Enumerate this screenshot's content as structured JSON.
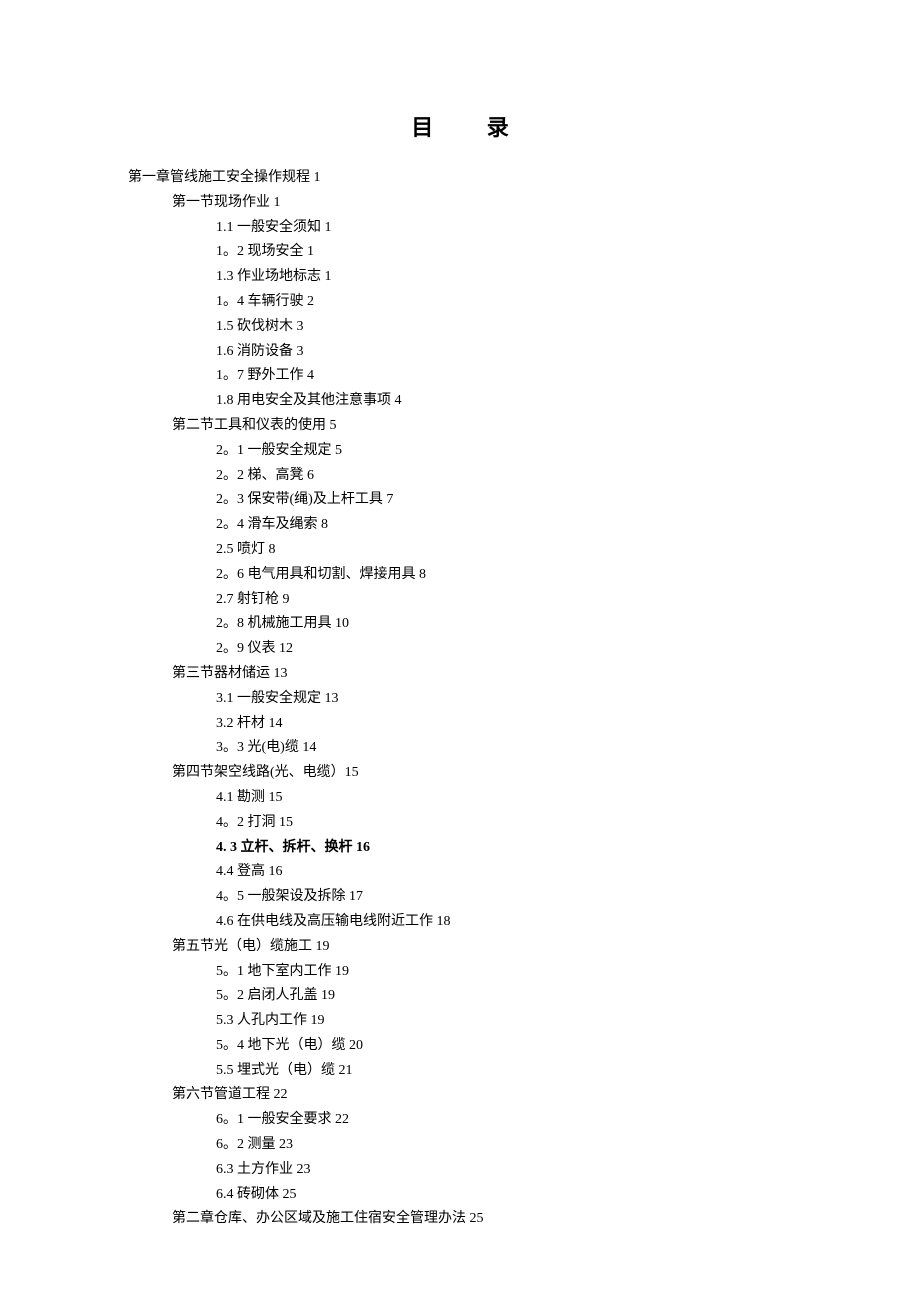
{
  "title": "目 录",
  "entries": [
    {
      "indent": 0,
      "text": "第一章管线施工安全操作规程 1",
      "bold": false
    },
    {
      "indent": 1,
      "text": "第一节现场作业 1",
      "bold": false
    },
    {
      "indent": 2,
      "text": "1.1 一般安全须知 1",
      "bold": false
    },
    {
      "indent": 2,
      "text": "1。2 现场安全 1",
      "bold": false
    },
    {
      "indent": 2,
      "text": "1.3 作业场地标志 1",
      "bold": false
    },
    {
      "indent": 2,
      "text": "1。4 车辆行驶 2",
      "bold": false
    },
    {
      "indent": 2,
      "text": "1.5 砍伐树木 3",
      "bold": false
    },
    {
      "indent": 2,
      "text": "1.6 消防设备 3",
      "bold": false
    },
    {
      "indent": 2,
      "text": "1。7 野外工作 4",
      "bold": false
    },
    {
      "indent": 2,
      "text": "1.8 用电安全及其他注意事项 4",
      "bold": false
    },
    {
      "indent": 1,
      "text": "第二节工具和仪表的使用 5",
      "bold": false
    },
    {
      "indent": 2,
      "text": "2。1 一般安全规定 5",
      "bold": false
    },
    {
      "indent": 2,
      "text": "2。2 梯、高凳 6",
      "bold": false
    },
    {
      "indent": 2,
      "text": "2。3 保安带(绳)及上杆工具 7",
      "bold": false
    },
    {
      "indent": 2,
      "text": "2。4 滑车及绳索 8",
      "bold": false
    },
    {
      "indent": 2,
      "text": "2.5 喷灯 8",
      "bold": false
    },
    {
      "indent": 2,
      "text": "2。6 电气用具和切割、焊接用具 8",
      "bold": false
    },
    {
      "indent": 2,
      "text": "2.7 射钉枪 9",
      "bold": false
    },
    {
      "indent": 2,
      "text": "2。8 机械施工用具 10",
      "bold": false
    },
    {
      "indent": 2,
      "text": "2。9 仪表 12",
      "bold": false
    },
    {
      "indent": 1,
      "text": "第三节器材储运 13",
      "bold": false
    },
    {
      "indent": 2,
      "text": "3.1 一般安全规定 13",
      "bold": false
    },
    {
      "indent": 2,
      "text": "3.2 杆材 14",
      "bold": false
    },
    {
      "indent": 2,
      "text": "3。3 光(电)缆 14",
      "bold": false
    },
    {
      "indent": 1,
      "text": "第四节架空线路(光、电缆）15",
      "bold": false
    },
    {
      "indent": 2,
      "text": "4.1 勘测 15",
      "bold": false
    },
    {
      "indent": 2,
      "text": "4。2 打洞 15",
      "bold": false
    },
    {
      "indent": 2,
      "text": "4. 3 立杆、拆杆、换杆 16",
      "bold": true
    },
    {
      "indent": 2,
      "text": "4.4 登高 16",
      "bold": false
    },
    {
      "indent": 2,
      "text": "4。5 一般架设及拆除 17",
      "bold": false
    },
    {
      "indent": 2,
      "text": "4.6 在供电线及高压输电线附近工作 18",
      "bold": false
    },
    {
      "indent": 1,
      "text": "第五节光（电）缆施工 19",
      "bold": false
    },
    {
      "indent": 2,
      "text": "5。1 地下室内工作 19",
      "bold": false
    },
    {
      "indent": 2,
      "text": "5。2 启闭人孔盖 19",
      "bold": false
    },
    {
      "indent": 2,
      "text": "5.3 人孔内工作 19",
      "bold": false
    },
    {
      "indent": 2,
      "text": "5。4 地下光（电）缆 20",
      "bold": false
    },
    {
      "indent": 2,
      "text": "5.5 埋式光（电）缆 21",
      "bold": false
    },
    {
      "indent": 1,
      "text": "第六节管道工程 22",
      "bold": false
    },
    {
      "indent": 2,
      "text": "6。1 一般安全要求 22",
      "bold": false
    },
    {
      "indent": 2,
      "text": "6。2 测量 23",
      "bold": false
    },
    {
      "indent": 2,
      "text": "6.3 土方作业 23",
      "bold": false
    },
    {
      "indent": 2,
      "text": "6.4 砖砌体 25",
      "bold": false
    },
    {
      "indent": 1,
      "text": "第二章仓库、办公区域及施工住宿安全管理办法 25",
      "bold": false
    }
  ]
}
